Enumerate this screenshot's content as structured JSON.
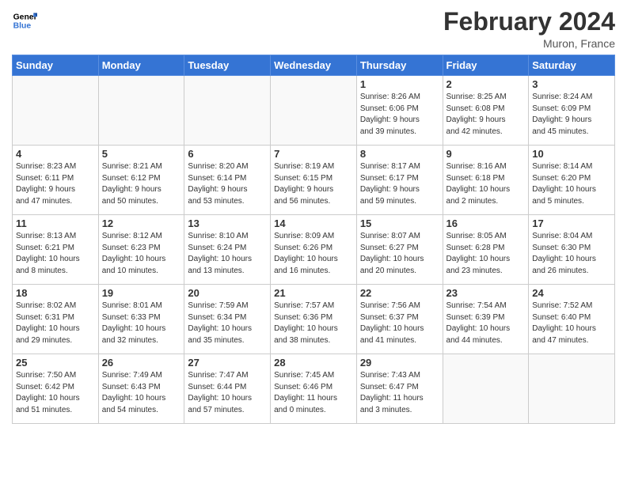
{
  "header": {
    "logo_line1": "General",
    "logo_line2": "Blue",
    "month_year": "February 2024",
    "location": "Muron, France"
  },
  "days_of_week": [
    "Sunday",
    "Monday",
    "Tuesday",
    "Wednesday",
    "Thursday",
    "Friday",
    "Saturday"
  ],
  "weeks": [
    [
      {
        "day": "",
        "info": ""
      },
      {
        "day": "",
        "info": ""
      },
      {
        "day": "",
        "info": ""
      },
      {
        "day": "",
        "info": ""
      },
      {
        "day": "1",
        "info": "Sunrise: 8:26 AM\nSunset: 6:06 PM\nDaylight: 9 hours\nand 39 minutes."
      },
      {
        "day": "2",
        "info": "Sunrise: 8:25 AM\nSunset: 6:08 PM\nDaylight: 9 hours\nand 42 minutes."
      },
      {
        "day": "3",
        "info": "Sunrise: 8:24 AM\nSunset: 6:09 PM\nDaylight: 9 hours\nand 45 minutes."
      }
    ],
    [
      {
        "day": "4",
        "info": "Sunrise: 8:23 AM\nSunset: 6:11 PM\nDaylight: 9 hours\nand 47 minutes."
      },
      {
        "day": "5",
        "info": "Sunrise: 8:21 AM\nSunset: 6:12 PM\nDaylight: 9 hours\nand 50 minutes."
      },
      {
        "day": "6",
        "info": "Sunrise: 8:20 AM\nSunset: 6:14 PM\nDaylight: 9 hours\nand 53 minutes."
      },
      {
        "day": "7",
        "info": "Sunrise: 8:19 AM\nSunset: 6:15 PM\nDaylight: 9 hours\nand 56 minutes."
      },
      {
        "day": "8",
        "info": "Sunrise: 8:17 AM\nSunset: 6:17 PM\nDaylight: 9 hours\nand 59 minutes."
      },
      {
        "day": "9",
        "info": "Sunrise: 8:16 AM\nSunset: 6:18 PM\nDaylight: 10 hours\nand 2 minutes."
      },
      {
        "day": "10",
        "info": "Sunrise: 8:14 AM\nSunset: 6:20 PM\nDaylight: 10 hours\nand 5 minutes."
      }
    ],
    [
      {
        "day": "11",
        "info": "Sunrise: 8:13 AM\nSunset: 6:21 PM\nDaylight: 10 hours\nand 8 minutes."
      },
      {
        "day": "12",
        "info": "Sunrise: 8:12 AM\nSunset: 6:23 PM\nDaylight: 10 hours\nand 10 minutes."
      },
      {
        "day": "13",
        "info": "Sunrise: 8:10 AM\nSunset: 6:24 PM\nDaylight: 10 hours\nand 13 minutes."
      },
      {
        "day": "14",
        "info": "Sunrise: 8:09 AM\nSunset: 6:26 PM\nDaylight: 10 hours\nand 16 minutes."
      },
      {
        "day": "15",
        "info": "Sunrise: 8:07 AM\nSunset: 6:27 PM\nDaylight: 10 hours\nand 20 minutes."
      },
      {
        "day": "16",
        "info": "Sunrise: 8:05 AM\nSunset: 6:28 PM\nDaylight: 10 hours\nand 23 minutes."
      },
      {
        "day": "17",
        "info": "Sunrise: 8:04 AM\nSunset: 6:30 PM\nDaylight: 10 hours\nand 26 minutes."
      }
    ],
    [
      {
        "day": "18",
        "info": "Sunrise: 8:02 AM\nSunset: 6:31 PM\nDaylight: 10 hours\nand 29 minutes."
      },
      {
        "day": "19",
        "info": "Sunrise: 8:01 AM\nSunset: 6:33 PM\nDaylight: 10 hours\nand 32 minutes."
      },
      {
        "day": "20",
        "info": "Sunrise: 7:59 AM\nSunset: 6:34 PM\nDaylight: 10 hours\nand 35 minutes."
      },
      {
        "day": "21",
        "info": "Sunrise: 7:57 AM\nSunset: 6:36 PM\nDaylight: 10 hours\nand 38 minutes."
      },
      {
        "day": "22",
        "info": "Sunrise: 7:56 AM\nSunset: 6:37 PM\nDaylight: 10 hours\nand 41 minutes."
      },
      {
        "day": "23",
        "info": "Sunrise: 7:54 AM\nSunset: 6:39 PM\nDaylight: 10 hours\nand 44 minutes."
      },
      {
        "day": "24",
        "info": "Sunrise: 7:52 AM\nSunset: 6:40 PM\nDaylight: 10 hours\nand 47 minutes."
      }
    ],
    [
      {
        "day": "25",
        "info": "Sunrise: 7:50 AM\nSunset: 6:42 PM\nDaylight: 10 hours\nand 51 minutes."
      },
      {
        "day": "26",
        "info": "Sunrise: 7:49 AM\nSunset: 6:43 PM\nDaylight: 10 hours\nand 54 minutes."
      },
      {
        "day": "27",
        "info": "Sunrise: 7:47 AM\nSunset: 6:44 PM\nDaylight: 10 hours\nand 57 minutes."
      },
      {
        "day": "28",
        "info": "Sunrise: 7:45 AM\nSunset: 6:46 PM\nDaylight: 11 hours\nand 0 minutes."
      },
      {
        "day": "29",
        "info": "Sunrise: 7:43 AM\nSunset: 6:47 PM\nDaylight: 11 hours\nand 3 minutes."
      },
      {
        "day": "",
        "info": ""
      },
      {
        "day": "",
        "info": ""
      }
    ]
  ]
}
